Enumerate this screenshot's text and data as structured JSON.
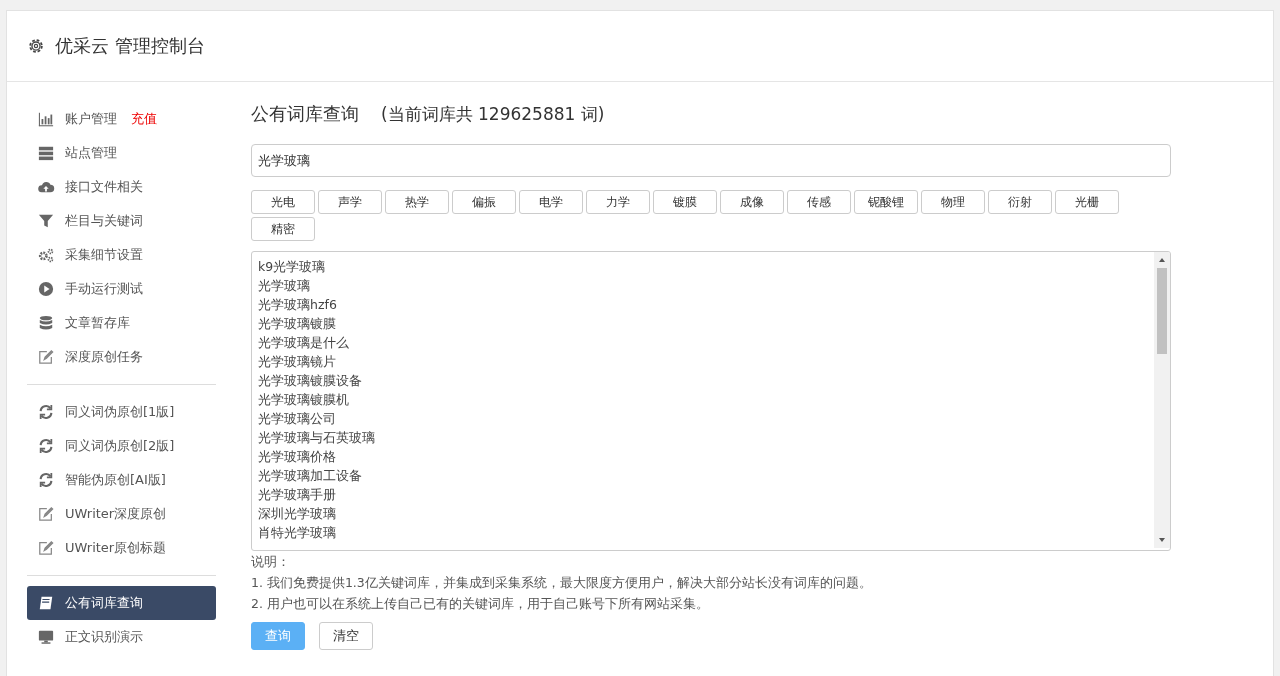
{
  "header": {
    "title": "优采云 管理控制台"
  },
  "sidebar": {
    "groups": [
      {
        "items": [
          {
            "label": "账户管理",
            "badge": "充值",
            "selected": false
          },
          {
            "label": "站点管理",
            "selected": false
          },
          {
            "label": "接口文件相关",
            "selected": false
          },
          {
            "label": "栏目与关键词",
            "selected": false
          },
          {
            "label": "采集细节设置",
            "selected": false
          },
          {
            "label": "手动运行测试",
            "selected": false
          },
          {
            "label": "文章暂存库",
            "selected": false
          },
          {
            "label": "深度原创任务",
            "selected": false
          }
        ]
      },
      {
        "items": [
          {
            "label": "同义词伪原创[1版]",
            "selected": false
          },
          {
            "label": "同义词伪原创[2版]",
            "selected": false
          },
          {
            "label": "智能伪原创[AI版]",
            "selected": false
          },
          {
            "label": "UWriter深度原创",
            "selected": false
          },
          {
            "label": "UWriter原创标题",
            "selected": false
          }
        ]
      },
      {
        "items": [
          {
            "label": "公有词库查询",
            "selected": true
          },
          {
            "label": "正文识别演示",
            "selected": false
          }
        ]
      }
    ]
  },
  "main": {
    "title": "公有词库查询",
    "count_note": "(当前词库共 129625881 词)",
    "search": {
      "value": "光学玻璃"
    },
    "tags": [
      "光电",
      "声学",
      "热学",
      "偏振",
      "电学",
      "力学",
      "镀膜",
      "成像",
      "传感",
      "铌酸锂",
      "物理",
      "衍射",
      "光栅",
      "精密"
    ],
    "results": [
      "k9光学玻璃",
      "光学玻璃",
      "光学玻璃hzf6",
      "光学玻璃镀膜",
      "光学玻璃是什么",
      "光学玻璃镜片",
      "光学玻璃镀膜设备",
      "光学玻璃镀膜机",
      "光学玻璃公司",
      "光学玻璃与石英玻璃",
      "光学玻璃价格",
      "光学玻璃加工设备",
      "光学玻璃手册",
      "深圳光学玻璃",
      "肖特光学玻璃"
    ],
    "notes_title": "说明：",
    "notes": [
      "1. 我们免费提供1.3亿关键词库，并集成到采集系统，最大限度方便用户，解决大部分站长没有词库的问题。",
      "2. 用户也可以在系统上传自己已有的关键词库，用于自己账号下所有网站采集。"
    ],
    "buttons": [
      {
        "label": "查询",
        "kind": "primary"
      },
      {
        "label": "清空",
        "kind": "default"
      }
    ]
  }
}
